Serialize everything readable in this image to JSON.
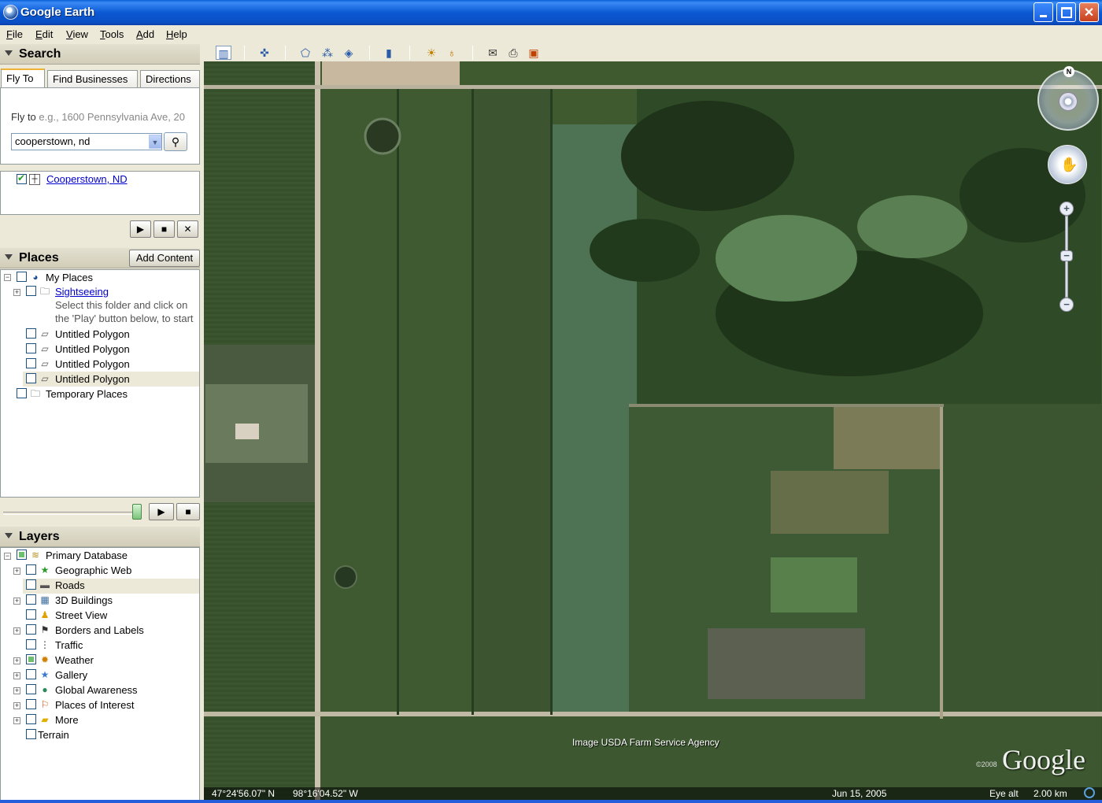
{
  "window": {
    "title": "Google Earth"
  },
  "menu": [
    "File",
    "Edit",
    "View",
    "Tools",
    "Add",
    "Help"
  ],
  "menu_underline": [
    "F",
    "E",
    "V",
    "T",
    "A",
    "H"
  ],
  "toolbar": {
    "icons": [
      "sidebar-toggle-icon",
      "placemark-icon",
      "polygon-icon",
      "path-icon",
      "image-overlay-icon",
      "ruler-icon",
      "sunlight-icon",
      "planets-icon",
      "email-icon",
      "print-icon",
      "view-in-maps-icon"
    ]
  },
  "search": {
    "heading": "Search",
    "tabs": [
      "Fly To",
      "Find Businesses",
      "Directions"
    ],
    "flyto_label": "Fly to",
    "flyto_example": "e.g., 1600 Pennsylvania Ave, 20",
    "query": "cooperstown, nd",
    "result": "Cooperstown, ND",
    "controls": [
      "play",
      "stop",
      "clear"
    ]
  },
  "places": {
    "heading": "Places",
    "add_content": "Add Content",
    "my_places": "My Places",
    "sightseeing": "Sightseeing",
    "sightseeing_hint_1": "Select this folder and click on",
    "sightseeing_hint_2": "the 'Play' button below, to start",
    "polygons": [
      "Untitled Polygon",
      "Untitled Polygon",
      "Untitled Polygon",
      "Untitled Polygon"
    ],
    "temporary": "Temporary Places"
  },
  "layers": {
    "heading": "Layers",
    "items": [
      {
        "label": "Primary Database",
        "icon": "database-icon"
      },
      {
        "label": "Geographic Web",
        "icon": "star-icon"
      },
      {
        "label": "Roads",
        "icon": "road-icon"
      },
      {
        "label": "3D Buildings",
        "icon": "building-icon"
      },
      {
        "label": "Street View",
        "icon": "person-icon"
      },
      {
        "label": "Borders and Labels",
        "icon": "flag-icon"
      },
      {
        "label": "Traffic",
        "icon": "traffic-light-icon"
      },
      {
        "label": "Weather",
        "icon": "sun-icon"
      },
      {
        "label": "Gallery",
        "icon": "star-icon"
      },
      {
        "label": "Global Awareness",
        "icon": "globe-icon"
      },
      {
        "label": "Places of Interest",
        "icon": "flag-icon"
      },
      {
        "label": "More",
        "icon": "folder-icon"
      },
      {
        "label": "Terrain",
        "icon": ""
      }
    ]
  },
  "map": {
    "credit": "Image USDA Farm Service Agency",
    "google_logo": "Google",
    "copyright": "©2008",
    "lat": "47°24'56.07\" N",
    "lon": "98°16'04.52\" W",
    "date": "Jun 15, 2005",
    "eye_alt_label": "Eye alt",
    "eye_alt_value": "2.00 km",
    "compass_n": "N"
  }
}
